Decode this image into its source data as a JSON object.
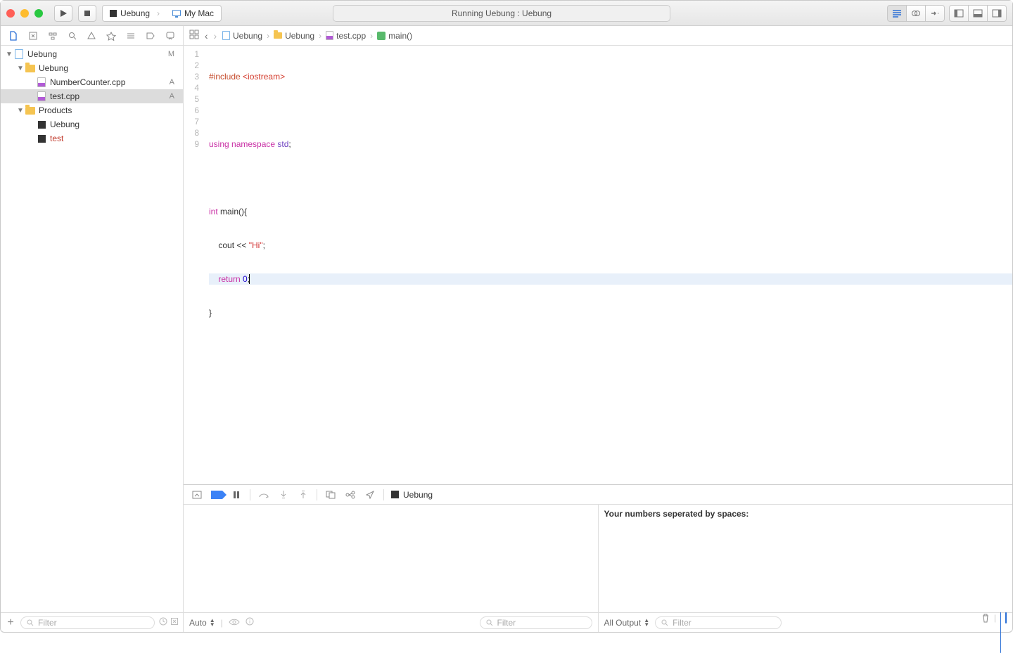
{
  "titlebar": {
    "scheme_target": "Uebung",
    "scheme_device": "My Mac",
    "status": "Running Uebung : Uebung"
  },
  "sidebar": {
    "filter_placeholder": "Filter",
    "tree": {
      "project": {
        "name": "Uebung",
        "badge": "M"
      },
      "group": {
        "name": "Uebung"
      },
      "files": [
        {
          "name": "NumberCounter.cpp",
          "badge": "A"
        },
        {
          "name": "test.cpp",
          "badge": "A",
          "selected": true
        }
      ],
      "products_label": "Products",
      "products": [
        {
          "name": "Uebung"
        },
        {
          "name": "test",
          "red": true
        }
      ]
    }
  },
  "jumpbar": {
    "items": [
      "Uebung",
      "Uebung",
      "test.cpp",
      "main()"
    ]
  },
  "code": {
    "lines": [
      {
        "n": "1",
        "pre": "#include ",
        "inc": "<iostream>"
      },
      {
        "n": "2",
        "plain": ""
      },
      {
        "n": "3",
        "kw": "using namespace",
        "ns": " std",
        "tail": ";"
      },
      {
        "n": "4",
        "plain": ""
      },
      {
        "n": "5",
        "ty": "int ",
        "fn": "main(){"
      },
      {
        "n": "6",
        "indent": "    ",
        "fn2": "cout << ",
        "str": "\"Hi\"",
        "tail": ";"
      },
      {
        "n": "7",
        "indent": "    ",
        "kw2": "return ",
        "num": "0",
        "tail": ";",
        "hl": true,
        "caret": true
      },
      {
        "n": "8",
        "plain": "}"
      },
      {
        "n": "9",
        "plain": ""
      }
    ]
  },
  "debug": {
    "process_label": "Uebung",
    "vars_scope": "Auto",
    "vars_filter_placeholder": "Filter",
    "console_mode": "All Output",
    "console_filter_placeholder": "Filter",
    "console_output": "Your numbers seperated by spaces:"
  }
}
